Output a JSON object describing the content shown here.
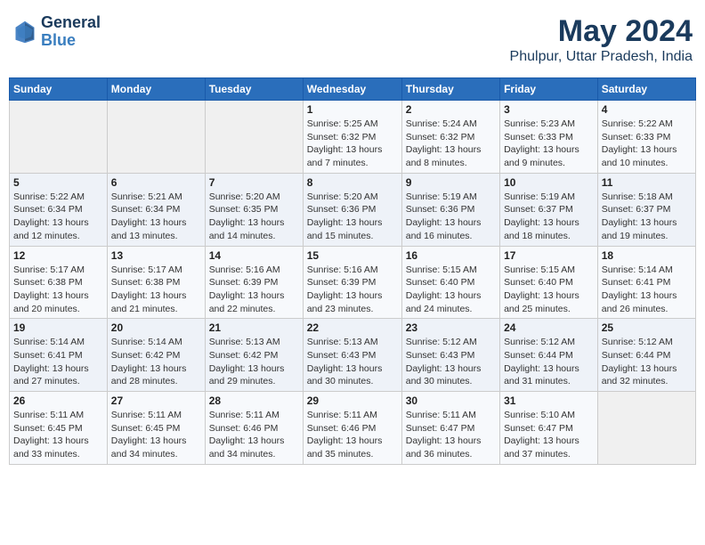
{
  "header": {
    "logo_line1": "General",
    "logo_line2": "Blue",
    "main_title": "May 2024",
    "subtitle": "Phulpur, Uttar Pradesh, India"
  },
  "days_of_week": [
    "Sunday",
    "Monday",
    "Tuesday",
    "Wednesday",
    "Thursday",
    "Friday",
    "Saturday"
  ],
  "weeks": [
    [
      {
        "day": "",
        "info": ""
      },
      {
        "day": "",
        "info": ""
      },
      {
        "day": "",
        "info": ""
      },
      {
        "day": "1",
        "info": "Sunrise: 5:25 AM\nSunset: 6:32 PM\nDaylight: 13 hours\nand 7 minutes."
      },
      {
        "day": "2",
        "info": "Sunrise: 5:24 AM\nSunset: 6:32 PM\nDaylight: 13 hours\nand 8 minutes."
      },
      {
        "day": "3",
        "info": "Sunrise: 5:23 AM\nSunset: 6:33 PM\nDaylight: 13 hours\nand 9 minutes."
      },
      {
        "day": "4",
        "info": "Sunrise: 5:22 AM\nSunset: 6:33 PM\nDaylight: 13 hours\nand 10 minutes."
      }
    ],
    [
      {
        "day": "5",
        "info": "Sunrise: 5:22 AM\nSunset: 6:34 PM\nDaylight: 13 hours\nand 12 minutes."
      },
      {
        "day": "6",
        "info": "Sunrise: 5:21 AM\nSunset: 6:34 PM\nDaylight: 13 hours\nand 13 minutes."
      },
      {
        "day": "7",
        "info": "Sunrise: 5:20 AM\nSunset: 6:35 PM\nDaylight: 13 hours\nand 14 minutes."
      },
      {
        "day": "8",
        "info": "Sunrise: 5:20 AM\nSunset: 6:36 PM\nDaylight: 13 hours\nand 15 minutes."
      },
      {
        "day": "9",
        "info": "Sunrise: 5:19 AM\nSunset: 6:36 PM\nDaylight: 13 hours\nand 16 minutes."
      },
      {
        "day": "10",
        "info": "Sunrise: 5:19 AM\nSunset: 6:37 PM\nDaylight: 13 hours\nand 18 minutes."
      },
      {
        "day": "11",
        "info": "Sunrise: 5:18 AM\nSunset: 6:37 PM\nDaylight: 13 hours\nand 19 minutes."
      }
    ],
    [
      {
        "day": "12",
        "info": "Sunrise: 5:17 AM\nSunset: 6:38 PM\nDaylight: 13 hours\nand 20 minutes."
      },
      {
        "day": "13",
        "info": "Sunrise: 5:17 AM\nSunset: 6:38 PM\nDaylight: 13 hours\nand 21 minutes."
      },
      {
        "day": "14",
        "info": "Sunrise: 5:16 AM\nSunset: 6:39 PM\nDaylight: 13 hours\nand 22 minutes."
      },
      {
        "day": "15",
        "info": "Sunrise: 5:16 AM\nSunset: 6:39 PM\nDaylight: 13 hours\nand 23 minutes."
      },
      {
        "day": "16",
        "info": "Sunrise: 5:15 AM\nSunset: 6:40 PM\nDaylight: 13 hours\nand 24 minutes."
      },
      {
        "day": "17",
        "info": "Sunrise: 5:15 AM\nSunset: 6:40 PM\nDaylight: 13 hours\nand 25 minutes."
      },
      {
        "day": "18",
        "info": "Sunrise: 5:14 AM\nSunset: 6:41 PM\nDaylight: 13 hours\nand 26 minutes."
      }
    ],
    [
      {
        "day": "19",
        "info": "Sunrise: 5:14 AM\nSunset: 6:41 PM\nDaylight: 13 hours\nand 27 minutes."
      },
      {
        "day": "20",
        "info": "Sunrise: 5:14 AM\nSunset: 6:42 PM\nDaylight: 13 hours\nand 28 minutes."
      },
      {
        "day": "21",
        "info": "Sunrise: 5:13 AM\nSunset: 6:42 PM\nDaylight: 13 hours\nand 29 minutes."
      },
      {
        "day": "22",
        "info": "Sunrise: 5:13 AM\nSunset: 6:43 PM\nDaylight: 13 hours\nand 30 minutes."
      },
      {
        "day": "23",
        "info": "Sunrise: 5:12 AM\nSunset: 6:43 PM\nDaylight: 13 hours\nand 30 minutes."
      },
      {
        "day": "24",
        "info": "Sunrise: 5:12 AM\nSunset: 6:44 PM\nDaylight: 13 hours\nand 31 minutes."
      },
      {
        "day": "25",
        "info": "Sunrise: 5:12 AM\nSunset: 6:44 PM\nDaylight: 13 hours\nand 32 minutes."
      }
    ],
    [
      {
        "day": "26",
        "info": "Sunrise: 5:11 AM\nSunset: 6:45 PM\nDaylight: 13 hours\nand 33 minutes."
      },
      {
        "day": "27",
        "info": "Sunrise: 5:11 AM\nSunset: 6:45 PM\nDaylight: 13 hours\nand 34 minutes."
      },
      {
        "day": "28",
        "info": "Sunrise: 5:11 AM\nSunset: 6:46 PM\nDaylight: 13 hours\nand 34 minutes."
      },
      {
        "day": "29",
        "info": "Sunrise: 5:11 AM\nSunset: 6:46 PM\nDaylight: 13 hours\nand 35 minutes."
      },
      {
        "day": "30",
        "info": "Sunrise: 5:11 AM\nSunset: 6:47 PM\nDaylight: 13 hours\nand 36 minutes."
      },
      {
        "day": "31",
        "info": "Sunrise: 5:10 AM\nSunset: 6:47 PM\nDaylight: 13 hours\nand 37 minutes."
      },
      {
        "day": "",
        "info": ""
      }
    ]
  ]
}
